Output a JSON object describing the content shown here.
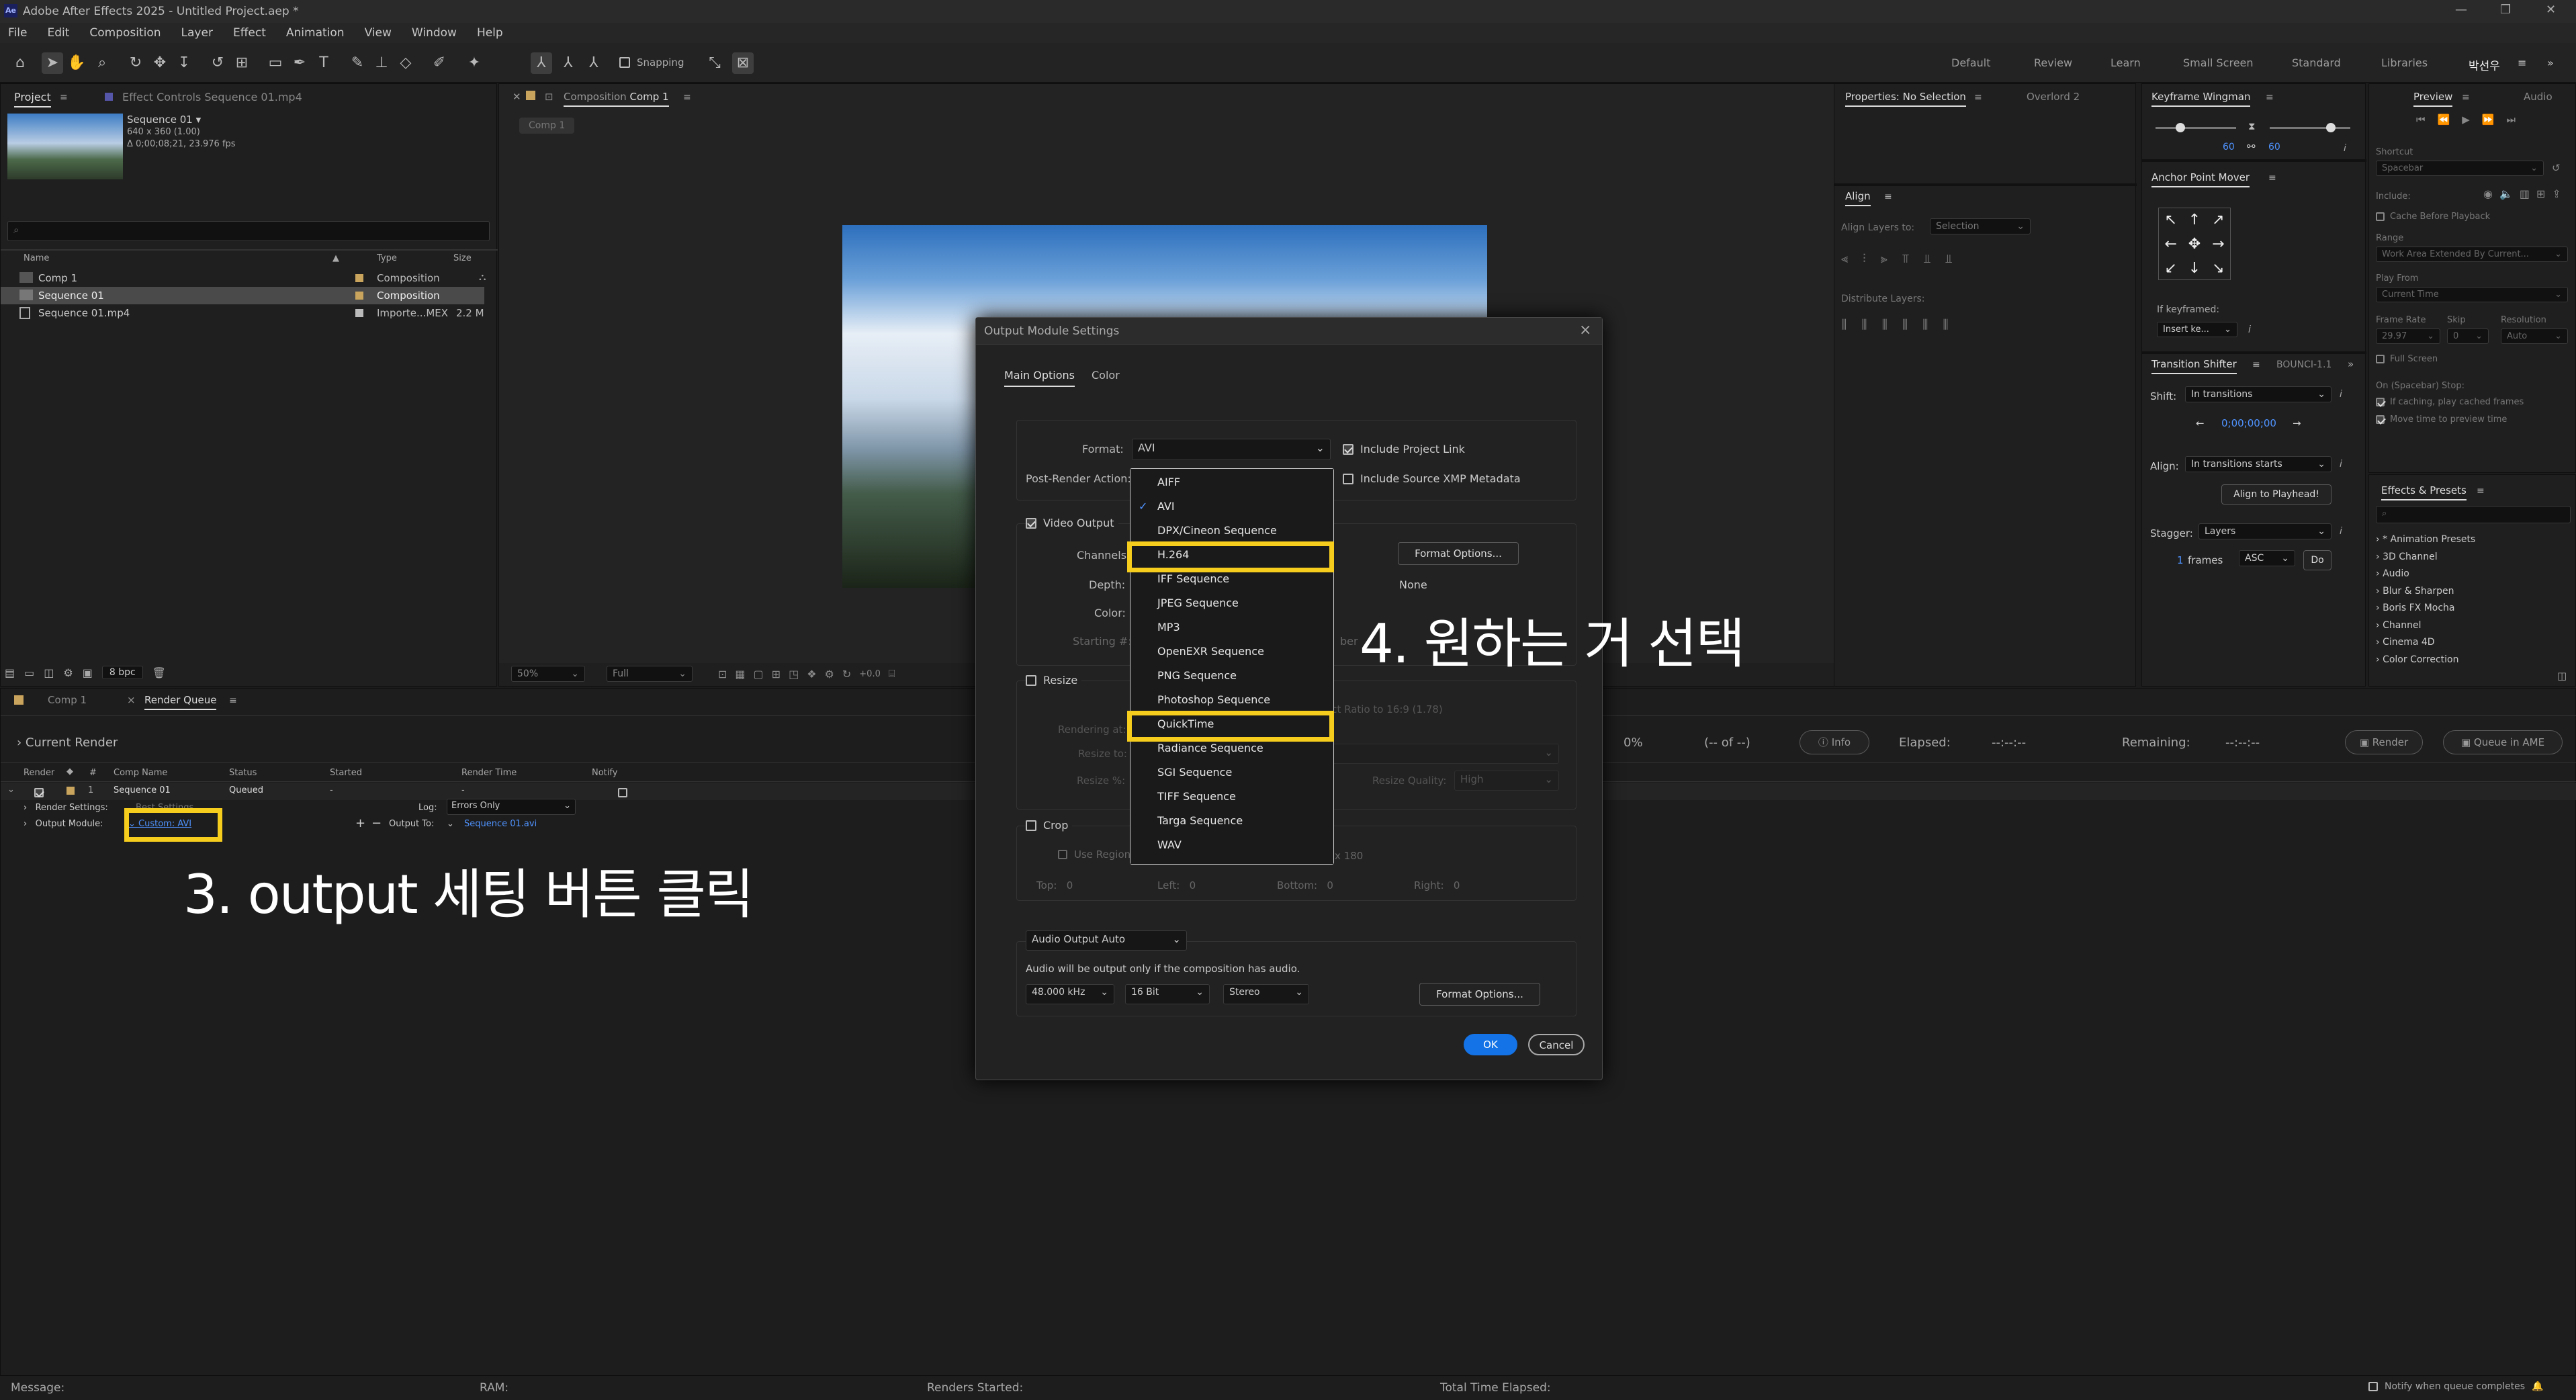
{
  "window": {
    "title": "Adobe After Effects 2025 - Untitled Project.aep *",
    "logo": "Ae"
  },
  "menu": [
    "File",
    "Edit",
    "Composition",
    "Layer",
    "Effect",
    "Animation",
    "View",
    "Window",
    "Help"
  ],
  "toolbar": {
    "snapping": "Snapping"
  },
  "workspaces": [
    "Default",
    "Review",
    "Learn",
    "Small Screen",
    "Standard",
    "Libraries",
    "박선우"
  ],
  "project": {
    "tab": "Project",
    "effect_controls_tab": "Effect Controls Sequence 01.mp4",
    "thumb_name": "Sequence 01",
    "thumb_info1": "640 x 360 (1.00)",
    "thumb_info2": "Δ 0;00;08;21, 23.976 fps",
    "search_placeholder": "⌕",
    "columns": [
      "Name",
      "Type",
      "Size"
    ],
    "items": [
      {
        "name": "Comp 1",
        "type": "Composition",
        "size": ""
      },
      {
        "name": "Sequence 01",
        "type": "Composition",
        "size": ""
      },
      {
        "name": "Sequence 01.mp4",
        "type": "Importe...MEX",
        "size": "2.2 M"
      }
    ],
    "bpc": "8 bpc"
  },
  "composition": {
    "tab": "Composition",
    "name": "Comp 1",
    "flow_tab": "Comp 1",
    "zoom": "50%",
    "quality": "Full",
    "exposure": "+0.0"
  },
  "properties": {
    "tab": "Properties: No Selection",
    "overlord": "Overlord 2",
    "align": "Align",
    "align_layers_to": "Align Layers to:",
    "align_selection": "Selection",
    "distribute": "Distribute Layers:"
  },
  "keyframe_wingman": {
    "title": "Keyframe Wingman",
    "val1": "60",
    "val2": "60"
  },
  "anchor_mover": {
    "title": "Anchor Point Mover",
    "if_keyframed": "If keyframed:",
    "insert": "Insert ke..."
  },
  "transition_shifter": {
    "title": "Transition Shifter",
    "bounce": "BOUNCΙ-1.1",
    "shift_label": "Shift:",
    "shift_val": "In transitions",
    "time": "0;00;00;00",
    "align_label": "Align:",
    "align_val": "In transitions starts",
    "align_to_playhead": "Align to Playhead!",
    "stagger_label": "Stagger:",
    "stagger_val": "Layers",
    "frames_num": "1",
    "frames": "frames",
    "order": "ASC",
    "do": "Do"
  },
  "preview": {
    "tab": "Preview",
    "audio_tab": "Audio",
    "shortcut": "Shortcut",
    "spacebar": "Spacebar",
    "include": "Include:",
    "cache_before": "Cache Before Playback",
    "range": "Range",
    "range_val": "Work Area Extended By Current...",
    "play_from": "Play From",
    "play_from_val": "Current Time",
    "frame_rate": "Frame Rate",
    "skip": "Skip",
    "resolution": "Resolution",
    "fr_val": "29.97",
    "skip_val": "0",
    "res_val": "Auto",
    "full_screen": "Full Screen",
    "on_stop": "On (Spacebar) Stop:",
    "if_caching": "If caching, play cached frames",
    "move_time": "Move time to preview time"
  },
  "effects": {
    "tab": "Effects & Presets",
    "items": [
      "* Animation Presets",
      "3D Channel",
      "Audio",
      "Blur & Sharpen",
      "Boris FX Mocha",
      "Channel",
      "Cinema 4D",
      "Color Correction"
    ]
  },
  "render_queue": {
    "comp_tab": "Comp 1",
    "tab": "Render Queue",
    "current_render": "Current Render",
    "percent": "0%",
    "of": "(-- of --)",
    "info": "Info",
    "elapsed_label": "Elapsed:",
    "elapsed": "--:--:--",
    "remaining_label": "Remaining:",
    "remaining": "--:--:--",
    "render_btn": "Render",
    "queue_ame": "Queue in AME",
    "columns": [
      "Render",
      "#",
      "Comp Name",
      "Status",
      "Started",
      "Render Time",
      "Notify"
    ],
    "row": {
      "num": "1",
      "comp": "Sequence 01",
      "status": "Queued",
      "started": "-",
      "render_time": "-"
    },
    "render_settings_label": "Render Settings:",
    "render_settings_val": "Best Settings",
    "log_label": "Log:",
    "log_val": "Errors Only",
    "output_module_label": "Output Module:",
    "output_module_val": "Custom: AVI",
    "output_to_label": "Output To:",
    "output_to_val": "Sequence 01.avi"
  },
  "status": {
    "message": "Message:",
    "ram": "RAM:",
    "renders_started": "Renders Started:",
    "total_time": "Total Time Elapsed:",
    "notify": "Notify when queue completes"
  },
  "dialog": {
    "title": "Output Module Settings",
    "tab_main": "Main Options",
    "tab_color": "Color",
    "format_label": "Format:",
    "format_val": "AVI",
    "include_project_link": "Include Project Link",
    "post_render_label": "Post-Render Action:",
    "include_xmp": "Include Source XMP Metadata",
    "video_output": "Video Output",
    "channels_label": "Channels:",
    "depth_label": "Depth:",
    "color_label": "Color:",
    "starting_label": "Starting #:",
    "format_options": "Format Options...",
    "none": "None",
    "number_partial": "ber",
    "resize": "Resize",
    "rendering_at": "Rendering at:",
    "resize_to": "Resize to:",
    "resize_pct": "Resize %:",
    "aspect": "ect Ratio to 16:9 (1.78)",
    "resize_quality": "Resize Quality:",
    "high": "High",
    "crop": "Crop",
    "use_region": "Use Region",
    "region_val": "x 180",
    "top": "Top:",
    "left": "Left:",
    "bottom": "Bottom:",
    "right": "Right:",
    "zero": "0",
    "audio_auto": "Audio Output Auto",
    "audio_note": "Audio will be output only if the composition has audio.",
    "khz": "48.000 kHz",
    "bit": "16 Bit",
    "stereo": "Stereo",
    "audio_format_options": "Format Options...",
    "ok": "OK",
    "cancel": "Cancel",
    "formats": [
      "AIFF",
      "AVI",
      "DPX/Cineon Sequence",
      "H.264",
      "IFF Sequence",
      "JPEG Sequence",
      "MP3",
      "OpenEXR Sequence",
      "PNG Sequence",
      "Photoshop Sequence",
      "QuickTime",
      "Radiance Sequence",
      "SGI Sequence",
      "TIFF Sequence",
      "Targa Sequence",
      "WAV"
    ]
  },
  "annotations": {
    "step3": "3. output 세팅 버튼 클릭",
    "step4": "4. 원하는 거 선택"
  },
  "colors": {
    "accent": "#4f93ff",
    "highlight": "#f6cd1d",
    "bg": "#1c1c1c"
  }
}
